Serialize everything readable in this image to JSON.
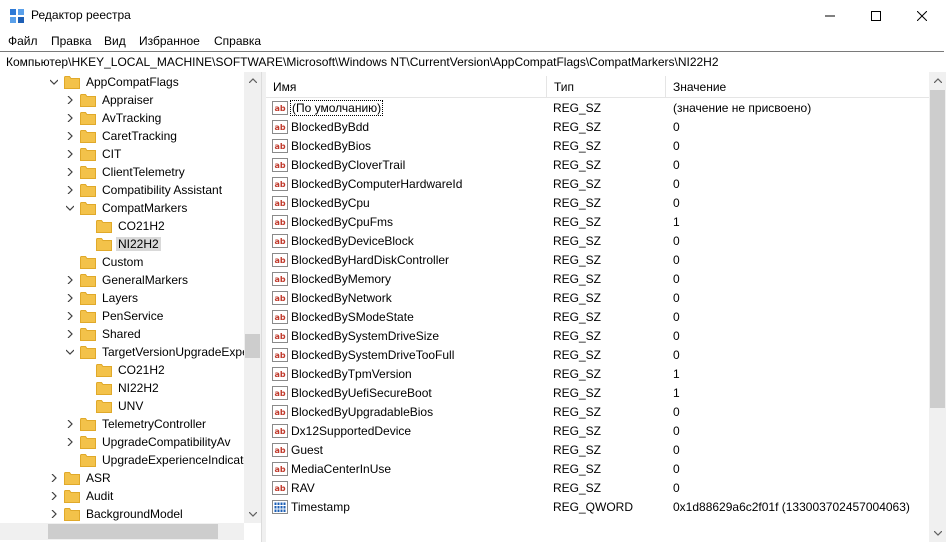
{
  "window": {
    "title": "Редактор реестра"
  },
  "menu": [
    "Файл",
    "Правка",
    "Вид",
    "Избранное",
    "Справка"
  ],
  "address": "Компьютер\\HKEY_LOCAL_MACHINE\\SOFTWARE\\Microsoft\\Windows NT\\CurrentVersion\\AppCompatFlags\\CompatMarkers\\NI22H2",
  "tree": [
    {
      "label": "AppCompatFlags",
      "level": 1,
      "expanded": true,
      "hasChildren": true
    },
    {
      "label": "Appraiser",
      "level": 2,
      "expanded": false,
      "hasChildren": true
    },
    {
      "label": "AvTracking",
      "level": 2,
      "expanded": false,
      "hasChildren": true
    },
    {
      "label": "CaretTracking",
      "level": 2,
      "expanded": false,
      "hasChildren": true
    },
    {
      "label": "CIT",
      "level": 2,
      "expanded": false,
      "hasChildren": true
    },
    {
      "label": "ClientTelemetry",
      "level": 2,
      "expanded": false,
      "hasChildren": true
    },
    {
      "label": "Compatibility Assistant",
      "level": 2,
      "expanded": false,
      "hasChildren": true
    },
    {
      "label": "CompatMarkers",
      "level": 2,
      "expanded": true,
      "hasChildren": true
    },
    {
      "label": "CO21H2",
      "level": 3,
      "expanded": false,
      "hasChildren": false
    },
    {
      "label": "NI22H2",
      "level": 3,
      "expanded": false,
      "hasChildren": false,
      "selected": true
    },
    {
      "label": "Custom",
      "level": 2,
      "expanded": false,
      "hasChildren": false
    },
    {
      "label": "GeneralMarkers",
      "level": 2,
      "expanded": false,
      "hasChildren": true
    },
    {
      "label": "Layers",
      "level": 2,
      "expanded": false,
      "hasChildren": true
    },
    {
      "label": "PenService",
      "level": 2,
      "expanded": false,
      "hasChildren": true
    },
    {
      "label": "Shared",
      "level": 2,
      "expanded": false,
      "hasChildren": true
    },
    {
      "label": "TargetVersionUpgradeExper",
      "level": 2,
      "expanded": true,
      "hasChildren": true
    },
    {
      "label": "CO21H2",
      "level": 3,
      "expanded": false,
      "hasChildren": false
    },
    {
      "label": "NI22H2",
      "level": 3,
      "expanded": false,
      "hasChildren": false
    },
    {
      "label": "UNV",
      "level": 3,
      "expanded": false,
      "hasChildren": false
    },
    {
      "label": "TelemetryController",
      "level": 2,
      "expanded": false,
      "hasChildren": true
    },
    {
      "label": "UpgradeCompatibilityAv",
      "level": 2,
      "expanded": false,
      "hasChildren": true
    },
    {
      "label": "UpgradeExperienceIndicato",
      "level": 2,
      "expanded": false,
      "hasChildren": false
    },
    {
      "label": "ASR",
      "level": 1,
      "expanded": false,
      "hasChildren": true
    },
    {
      "label": "Audit",
      "level": 1,
      "expanded": false,
      "hasChildren": true
    },
    {
      "label": "BackgroundModel",
      "level": 1,
      "expanded": false,
      "hasChildren": true
    }
  ],
  "columns": {
    "name": "Имя",
    "type": "Тип",
    "value": "Значение"
  },
  "values": [
    {
      "name": "(По умолчанию)",
      "type": "REG_SZ",
      "data": "(значение не присвоено)",
      "kind": "sz",
      "focused": true
    },
    {
      "name": "BlockedByBdd",
      "type": "REG_SZ",
      "data": "0",
      "kind": "sz"
    },
    {
      "name": "BlockedByBios",
      "type": "REG_SZ",
      "data": "0",
      "kind": "sz"
    },
    {
      "name": "BlockedByCloverTrail",
      "type": "REG_SZ",
      "data": "0",
      "kind": "sz"
    },
    {
      "name": "BlockedByComputerHardwareId",
      "type": "REG_SZ",
      "data": "0",
      "kind": "sz"
    },
    {
      "name": "BlockedByCpu",
      "type": "REG_SZ",
      "data": "0",
      "kind": "sz"
    },
    {
      "name": "BlockedByCpuFms",
      "type": "REG_SZ",
      "data": "1",
      "kind": "sz"
    },
    {
      "name": "BlockedByDeviceBlock",
      "type": "REG_SZ",
      "data": "0",
      "kind": "sz"
    },
    {
      "name": "BlockedByHardDiskController",
      "type": "REG_SZ",
      "data": "0",
      "kind": "sz"
    },
    {
      "name": "BlockedByMemory",
      "type": "REG_SZ",
      "data": "0",
      "kind": "sz"
    },
    {
      "name": "BlockedByNetwork",
      "type": "REG_SZ",
      "data": "0",
      "kind": "sz"
    },
    {
      "name": "BlockedBySModeState",
      "type": "REG_SZ",
      "data": "0",
      "kind": "sz"
    },
    {
      "name": "BlockedBySystemDriveSize",
      "type": "REG_SZ",
      "data": "0",
      "kind": "sz"
    },
    {
      "name": "BlockedBySystemDriveTooFull",
      "type": "REG_SZ",
      "data": "0",
      "kind": "sz"
    },
    {
      "name": "BlockedByTpmVersion",
      "type": "REG_SZ",
      "data": "1",
      "kind": "sz"
    },
    {
      "name": "BlockedByUefiSecureBoot",
      "type": "REG_SZ",
      "data": "1",
      "kind": "sz"
    },
    {
      "name": "BlockedByUpgradableBios",
      "type": "REG_SZ",
      "data": "0",
      "kind": "sz"
    },
    {
      "name": "Dx12SupportedDevice",
      "type": "REG_SZ",
      "data": "0",
      "kind": "sz"
    },
    {
      "name": "Guest",
      "type": "REG_SZ",
      "data": "0",
      "kind": "sz"
    },
    {
      "name": "MediaCenterInUse",
      "type": "REG_SZ",
      "data": "0",
      "kind": "sz"
    },
    {
      "name": "RAV",
      "type": "REG_SZ",
      "data": "0",
      "kind": "sz"
    },
    {
      "name": "Timestamp",
      "type": "REG_QWORD",
      "data": "0x1d88629a6c2f01f (133003702457004063)",
      "kind": "bin"
    }
  ],
  "colors": {
    "folder": "#f3c24a",
    "folderDark": "#e0a92a",
    "sz_icon_red": "#c0392b",
    "bin_icon_blue": "#1d5fb5",
    "selected": "#d9d9d9"
  },
  "icons": {
    "app": "registry-editor-icon",
    "minimize": "minimize-icon",
    "maximize": "maximize-icon",
    "close": "close-icon"
  }
}
